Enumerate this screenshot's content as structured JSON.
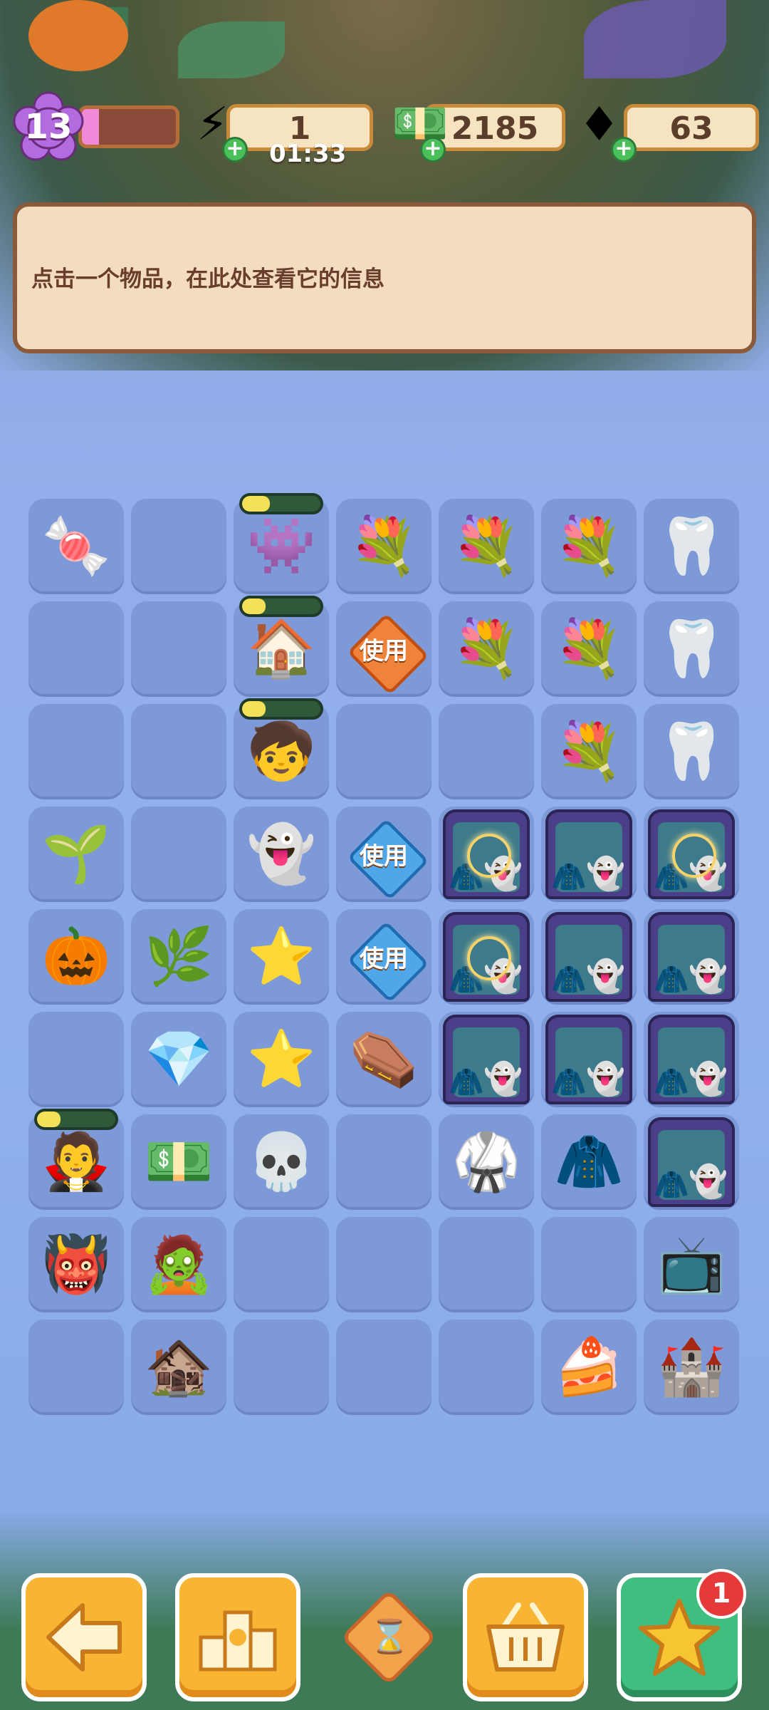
{
  "hud": {
    "level": "13",
    "xp_fraction": 0.18,
    "energy": "1",
    "energy_timer": "01:33",
    "cash": "2185",
    "gems": "63"
  },
  "info_panel": {
    "hint": "点击一个物品，在此处查看它的信息"
  },
  "board": {
    "use_label": "使用",
    "rows": [
      [
        "🍬",
        "",
        "👾",
        "💐",
        "💐",
        "💐",
        "🦷"
      ],
      [
        "",
        "",
        "🏠",
        "USE-ORANGE",
        "💐",
        "💐",
        "🦷"
      ],
      [
        "",
        "",
        "🧒",
        "",
        "",
        "💐",
        "🦷"
      ],
      [
        "🌱",
        "",
        "👻",
        "USE-BLUE",
        "COFFIN-S",
        "COFFIN",
        "COFFIN-S"
      ],
      [
        "🎃",
        "🌿",
        "⭐",
        "USE-BLUE",
        "COFFIN-S",
        "COFFIN",
        "COFFIN"
      ],
      [
        "",
        "💎",
        "⭐",
        "⚰️",
        "COFFIN",
        "COFFIN",
        "COFFIN"
      ],
      [
        "🧛",
        "💵",
        "💀",
        "",
        "🥋",
        "🧥",
        "COFFIN"
      ],
      [
        "👹",
        "🧟",
        "",
        "",
        "",
        "",
        "📺"
      ],
      [
        "",
        "🏚️",
        "",
        "",
        "",
        "🍰",
        "🏰"
      ]
    ],
    "progress": [
      {
        "row": 0,
        "col": 2,
        "fill": 0.35
      },
      {
        "row": 1,
        "col": 2,
        "fill": 0.3
      },
      {
        "row": 2,
        "col": 2,
        "fill": 0.3
      },
      {
        "row": 6,
        "col": 0,
        "fill": 0.3
      }
    ]
  },
  "bottom_bar": {
    "back_icon": "arrow-left-icon",
    "rank_icon": "podium-icon",
    "hourglass_icon": "hourglass-icon",
    "basket_icon": "basket-icon",
    "star_icon": "star-icon",
    "star_badge": "1"
  },
  "colors": {
    "board_bg": "#8fb0ec",
    "cell": "#7e99d8",
    "panel": "#f3dcc0",
    "button_orange": "#f7b533",
    "button_green": "#3fbf7f"
  }
}
